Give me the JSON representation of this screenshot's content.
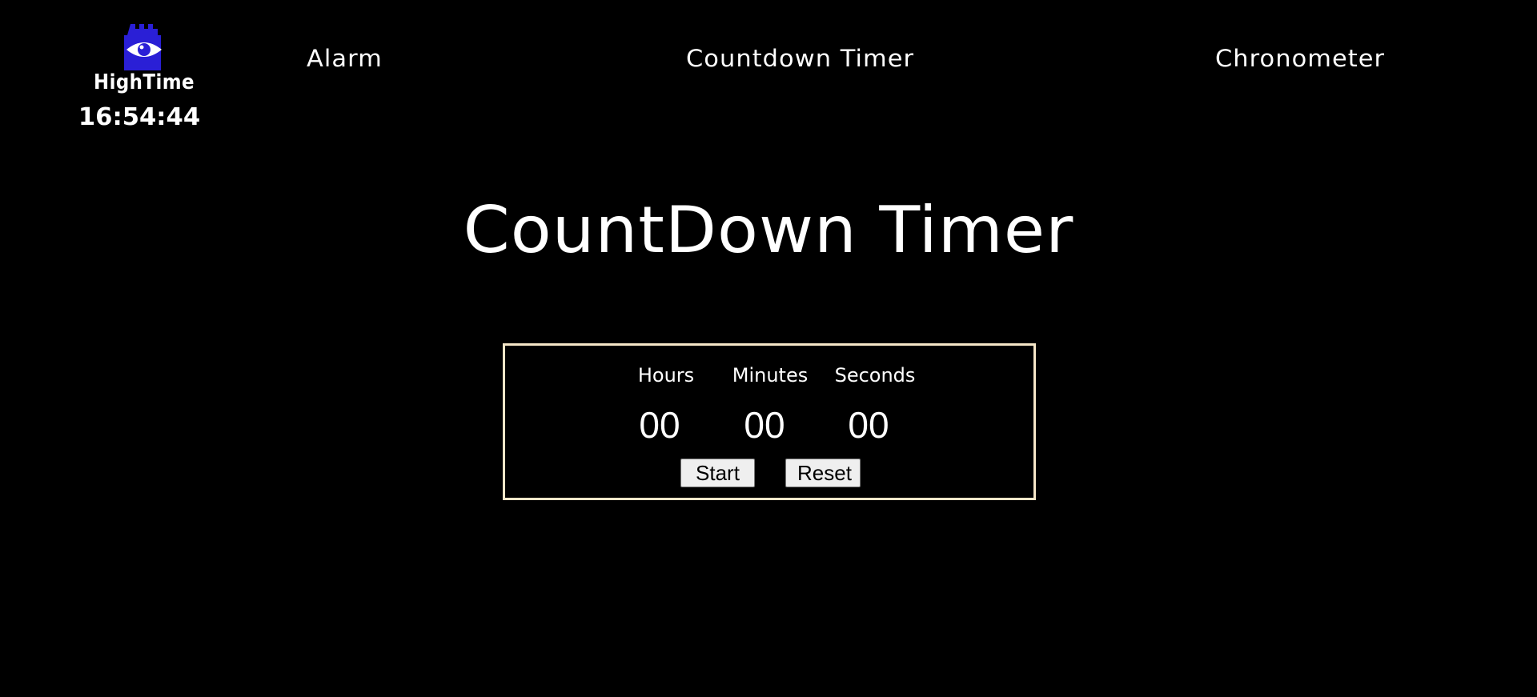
{
  "brand": {
    "name": "HighTime",
    "clock": "16:54:44",
    "logo_icon": "eye-tower-icon",
    "logo_color": "#2a1fd6"
  },
  "nav": {
    "alarm": "Alarm",
    "countdown": "Countdown Timer",
    "chronometer": "Chronometer"
  },
  "main": {
    "title": "CountDown Timer"
  },
  "timer": {
    "labels": {
      "hours": "Hours",
      "minutes": "Minutes",
      "seconds": "Seconds"
    },
    "values": {
      "hours": "00",
      "minutes": "00",
      "seconds": "00"
    },
    "start_label": "Start",
    "reset_label": "Reset",
    "border_color": "#f5e6c8"
  },
  "colors": {
    "background": "#000000",
    "text": "#ffffff"
  }
}
